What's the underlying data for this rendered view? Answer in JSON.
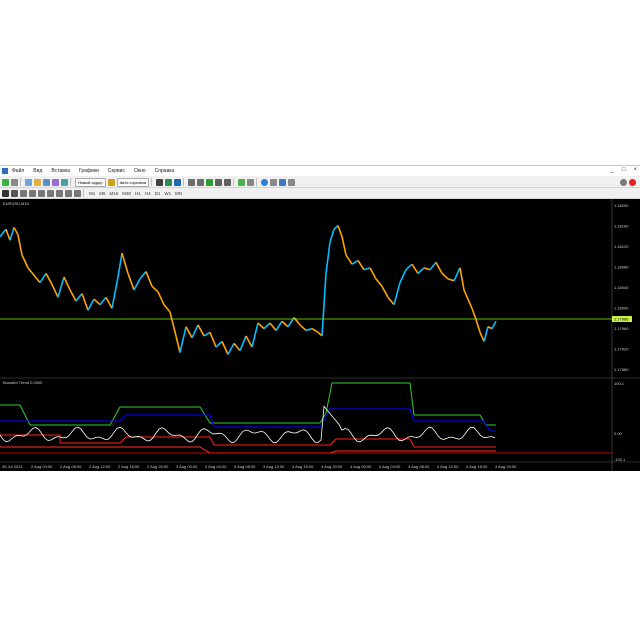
{
  "app": {
    "menu": [
      "Файл",
      "Вид",
      "Вставка",
      "Графики",
      "Сервис",
      "Окно",
      "Справка"
    ],
    "window_controls": [
      "_",
      "□",
      "×"
    ]
  },
  "toolbar": {
    "new_order_label": "Новый ордер",
    "autotrading_label": "Авто-торговля",
    "timeframes": [
      "M1",
      "M5",
      "M15",
      "M30",
      "H1",
      "H4",
      "D1",
      "W1",
      "MN"
    ]
  },
  "chart": {
    "symbol_label": "EURUSD,M15",
    "price_levels": [
      "1.18200",
      "1.18160",
      "1.18120",
      "1.18080",
      "1.18040",
      "1.18000",
      "1.17960",
      "1.17920",
      "1.17880"
    ],
    "current_price": "1.17986",
    "indicator_label": "Boosted Trend 0.0000",
    "indicator_levels": [
      "100.1",
      "0.00",
      "-100.1"
    ],
    "time_labels": [
      "30 Jul 2021",
      "2 Aug 04:00",
      "2 Aug 08:00",
      "2 Aug 12:00",
      "2 Aug 16:00",
      "2 Aug 20:00",
      "3 Aug 00:00",
      "3 Aug 04:00",
      "3 Aug 08:00",
      "3 Aug 12:00",
      "3 Aug 16:00",
      "3 Aug 20:00",
      "4 Aug 00:00",
      "4 Aug 04:00",
      "4 Aug 08:00",
      "4 Aug 12:00",
      "4 Aug 16:00",
      "4 Aug 20:00"
    ],
    "colors": {
      "background": "#000000",
      "line_green": "#7cfc00",
      "bull": "#00bfff",
      "bear": "#ffa500",
      "indicator_upper": "#32cd32",
      "indicator_mid": "#0000ff",
      "indicator_signal": "#ffffff",
      "indicator_lower": "#ff2020",
      "zero_line": "#ff0000"
    }
  }
}
